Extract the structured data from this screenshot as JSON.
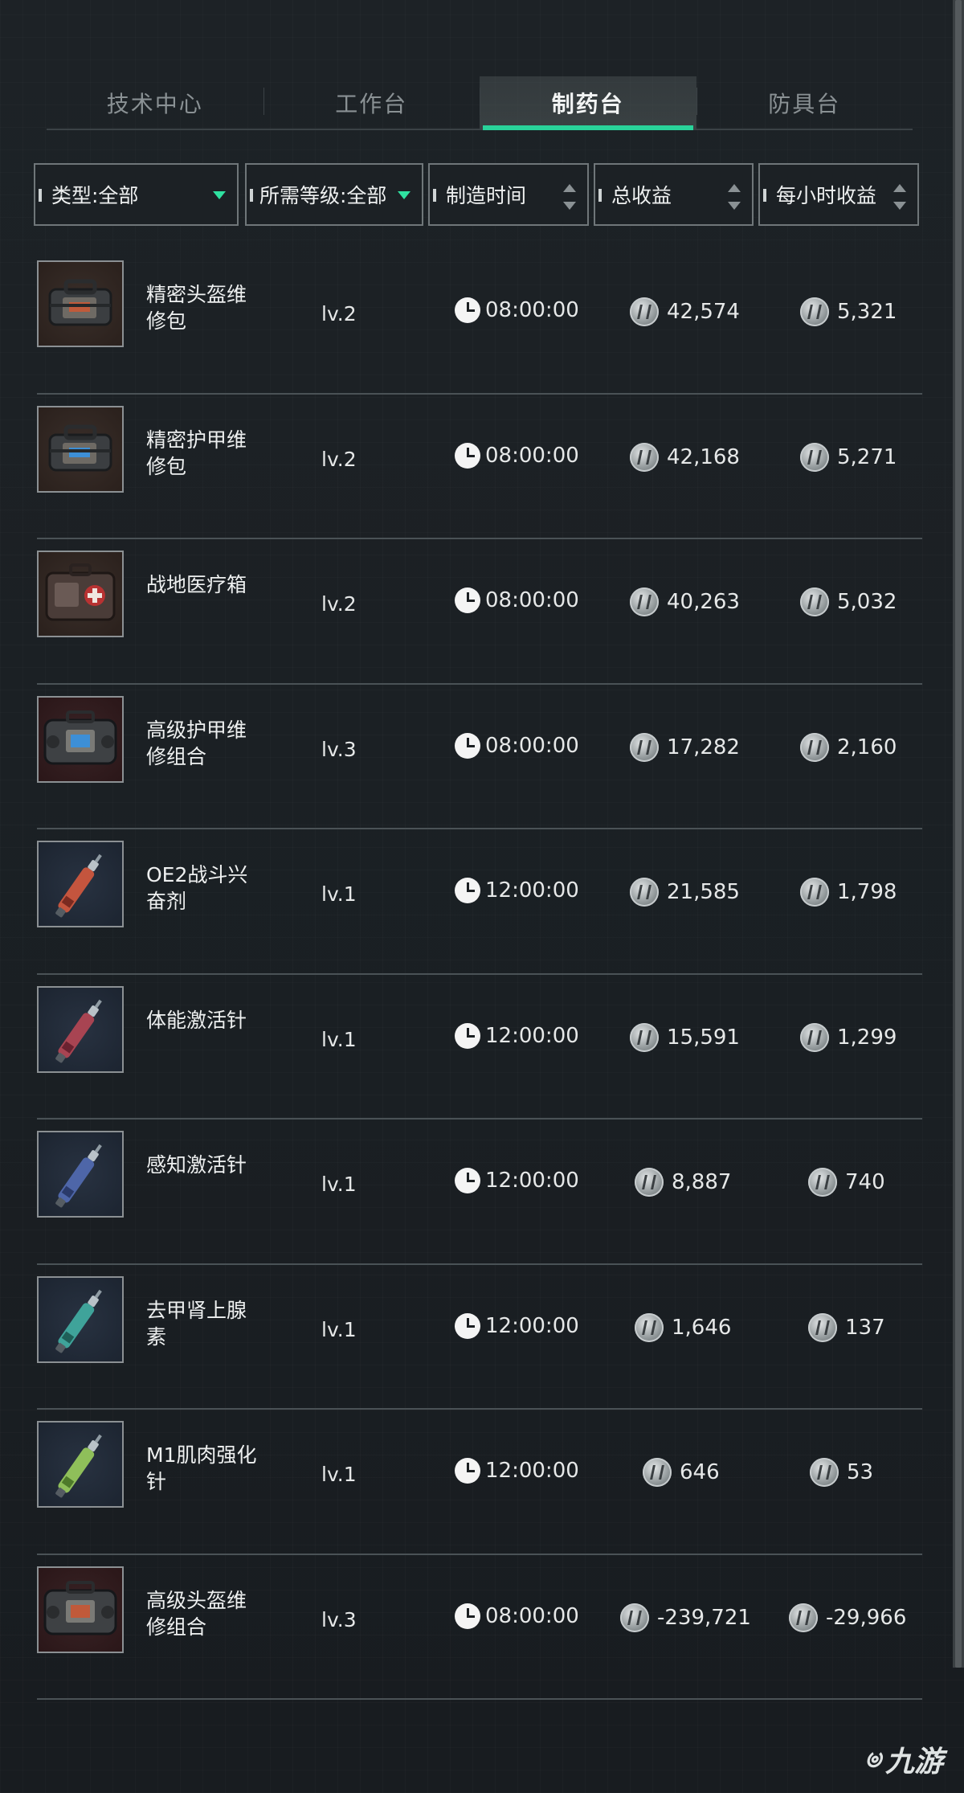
{
  "tabs": [
    {
      "label": "技术中心",
      "active": false
    },
    {
      "label": "工作台",
      "active": false
    },
    {
      "label": "制药台",
      "active": true
    },
    {
      "label": "防具台",
      "active": false
    }
  ],
  "filters": {
    "type": "类型:全部",
    "level": "所需等级:全部",
    "time": "制造时间",
    "total": "总收益",
    "hourly": "每小时收益"
  },
  "accent_color": "#29d39a",
  "items": [
    {
      "name": "精密头盔维修包",
      "level": "lv.2",
      "time": "08:00:00",
      "total": "42,574",
      "hourly": "5,321",
      "icon": "helmet-repair-kit-icon"
    },
    {
      "name": "精密护甲维修包",
      "level": "lv.2",
      "time": "08:00:00",
      "total": "42,168",
      "hourly": "5,271",
      "icon": "armor-repair-kit-icon"
    },
    {
      "name": "战地医疗箱",
      "level": "lv.2",
      "time": "08:00:00",
      "total": "40,263",
      "hourly": "5,032",
      "icon": "field-medkit-icon"
    },
    {
      "name": "高级护甲维修组合",
      "level": "lv.3",
      "time": "08:00:00",
      "total": "17,282",
      "hourly": "2,160",
      "icon": "advanced-armor-repair-combo-icon"
    },
    {
      "name": "OE2战斗兴奋剂",
      "level": "lv.1",
      "time": "12:00:00",
      "total": "21,585",
      "hourly": "1,798",
      "icon": "combat-stimulant-injector-icon"
    },
    {
      "name": "体能激活针",
      "level": "lv.1",
      "time": "12:00:00",
      "total": "15,591",
      "hourly": "1,299",
      "icon": "stamina-injector-icon"
    },
    {
      "name": "感知激活针",
      "level": "lv.1",
      "time": "12:00:00",
      "total": "8,887",
      "hourly": "740",
      "icon": "perception-injector-icon"
    },
    {
      "name": "去甲肾上腺素",
      "level": "lv.1",
      "time": "12:00:00",
      "total": "1,646",
      "hourly": "137",
      "icon": "noradrenaline-injector-icon"
    },
    {
      "name": "M1肌肉强化针",
      "level": "lv.1",
      "time": "12:00:00",
      "total": "646",
      "hourly": "53",
      "icon": "muscle-injector-icon"
    },
    {
      "name": "高级头盔维修组合",
      "level": "lv.3",
      "time": "08:00:00",
      "total": "-239,721",
      "hourly": "-29,966",
      "icon": "advanced-helmet-repair-combo-icon"
    }
  ],
  "watermark": "九游"
}
